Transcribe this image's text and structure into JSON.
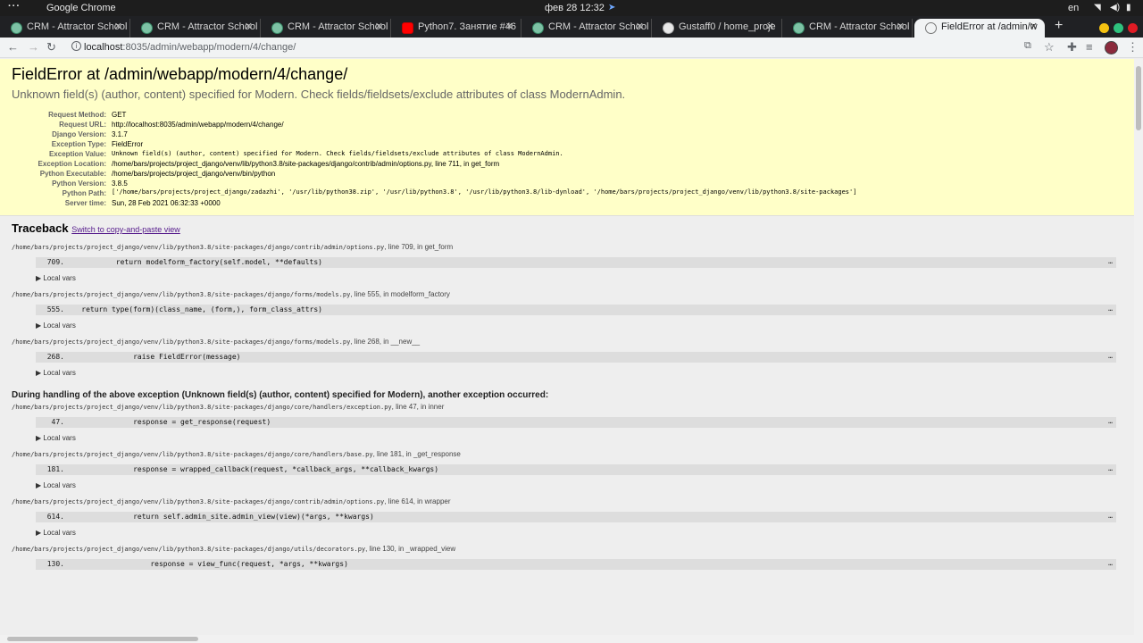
{
  "os": {
    "app_name": "Google Chrome",
    "clock": "фев 28  12:32",
    "language": "en"
  },
  "tabs": [
    {
      "title": "CRM - Attractor School",
      "icon": "crm-favicon"
    },
    {
      "title": "CRM - Attractor School",
      "icon": "crm-favicon"
    },
    {
      "title": "CRM - Attractor School",
      "icon": "crm-favicon"
    },
    {
      "title": "Python7. Занятие #46",
      "icon": "youtube-icon"
    },
    {
      "title": "CRM - Attractor School",
      "icon": "crm-favicon"
    },
    {
      "title": "Gustaff0 / home_proje",
      "icon": "github-icon"
    },
    {
      "title": "CRM - Attractor School",
      "icon": "crm-favicon"
    },
    {
      "title": "FieldError at /admin/w",
      "icon": "globe-icon",
      "active": true
    }
  ],
  "toolbar": {
    "url_host": "localhost",
    "url_rest": ":8035/admin/webapp/modern/4/change/"
  },
  "summary": {
    "title": "FieldError at /admin/webapp/modern/4/change/",
    "message": "Unknown field(s) (author, content) specified for Modern. Check fields/fieldsets/exclude attributes of class ModernAdmin.",
    "meta": [
      {
        "label": "Request Method:",
        "value": "GET"
      },
      {
        "label": "Request URL:",
        "value": "http://localhost:8035/admin/webapp/modern/4/change/"
      },
      {
        "label": "Django Version:",
        "value": "3.1.7"
      },
      {
        "label": "Exception Type:",
        "value": "FieldError"
      },
      {
        "label": "Exception Value:",
        "value": "Unknown field(s) (author, content) specified for Modern. Check fields/fieldsets/exclude attributes of class ModernAdmin."
      },
      {
        "label": "Exception Location:",
        "value": "/home/bars/projects/project_django/venv/lib/python3.8/site-packages/django/contrib/admin/options.py, line 711, in get_form"
      },
      {
        "label": "Python Executable:",
        "value": "/home/bars/projects/project_django/venv/bin/python"
      },
      {
        "label": "Python Version:",
        "value": "3.8.5"
      },
      {
        "label": "Python Path:",
        "value": "['/home/bars/projects/project_django/zadazhi',\n '/usr/lib/python38.zip',\n '/usr/lib/python3.8',\n '/usr/lib/python3.8/lib-dynload',\n '/home/bars/projects/project_django/venv/lib/python3.8/site-packages']"
      },
      {
        "label": "Server time:",
        "value": "Sun, 28 Feb 2021 06:32:33 +0000"
      }
    ]
  },
  "traceback": {
    "title": "Traceback",
    "switch_link": "Switch to copy-and-paste view",
    "local_vars_label": "▶ Local vars",
    "ellipsis": "…",
    "frames_a": [
      {
        "path": "/home/bars/projects/project_django/venv/lib/python3.8/site-packages/django/contrib/admin/options.py",
        "loc": ", line 709, in get_form",
        "lineno": "709.",
        "code": "            return modelform_factory(self.model, **defaults)"
      },
      {
        "path": "/home/bars/projects/project_django/venv/lib/python3.8/site-packages/django/forms/models.py",
        "loc": ", line 555, in modelform_factory",
        "lineno": "555.",
        "code": "    return type(form)(class_name, (form,), form_class_attrs)"
      },
      {
        "path": "/home/bars/projects/project_django/venv/lib/python3.8/site-packages/django/forms/models.py",
        "loc": ", line 268, in __new__",
        "lineno": "268.",
        "code": "                raise FieldError(message)"
      }
    ],
    "explanation": "During handling of the above exception (Unknown field(s) (author, content) specified for Modern), another exception occurred:",
    "frames_b": [
      {
        "path": "/home/bars/projects/project_django/venv/lib/python3.8/site-packages/django/core/handlers/exception.py",
        "loc": ", line 47, in inner",
        "lineno": "47.",
        "code": "                response = get_response(request)"
      },
      {
        "path": "/home/bars/projects/project_django/venv/lib/python3.8/site-packages/django/core/handlers/base.py",
        "loc": ", line 181, in _get_response",
        "lineno": "181.",
        "code": "                response = wrapped_callback(request, *callback_args, **callback_kwargs)"
      },
      {
        "path": "/home/bars/projects/project_django/venv/lib/python3.8/site-packages/django/contrib/admin/options.py",
        "loc": ", line 614, in wrapper",
        "lineno": "614.",
        "code": "                return self.admin_site.admin_view(view)(*args, **kwargs)"
      },
      {
        "path": "/home/bars/projects/project_django/venv/lib/python3.8/site-packages/django/utils/decorators.py",
        "loc": ", line 130, in _wrapped_view",
        "lineno": "130.",
        "code": "                    response = view_func(request, *args, **kwargs)"
      }
    ]
  }
}
